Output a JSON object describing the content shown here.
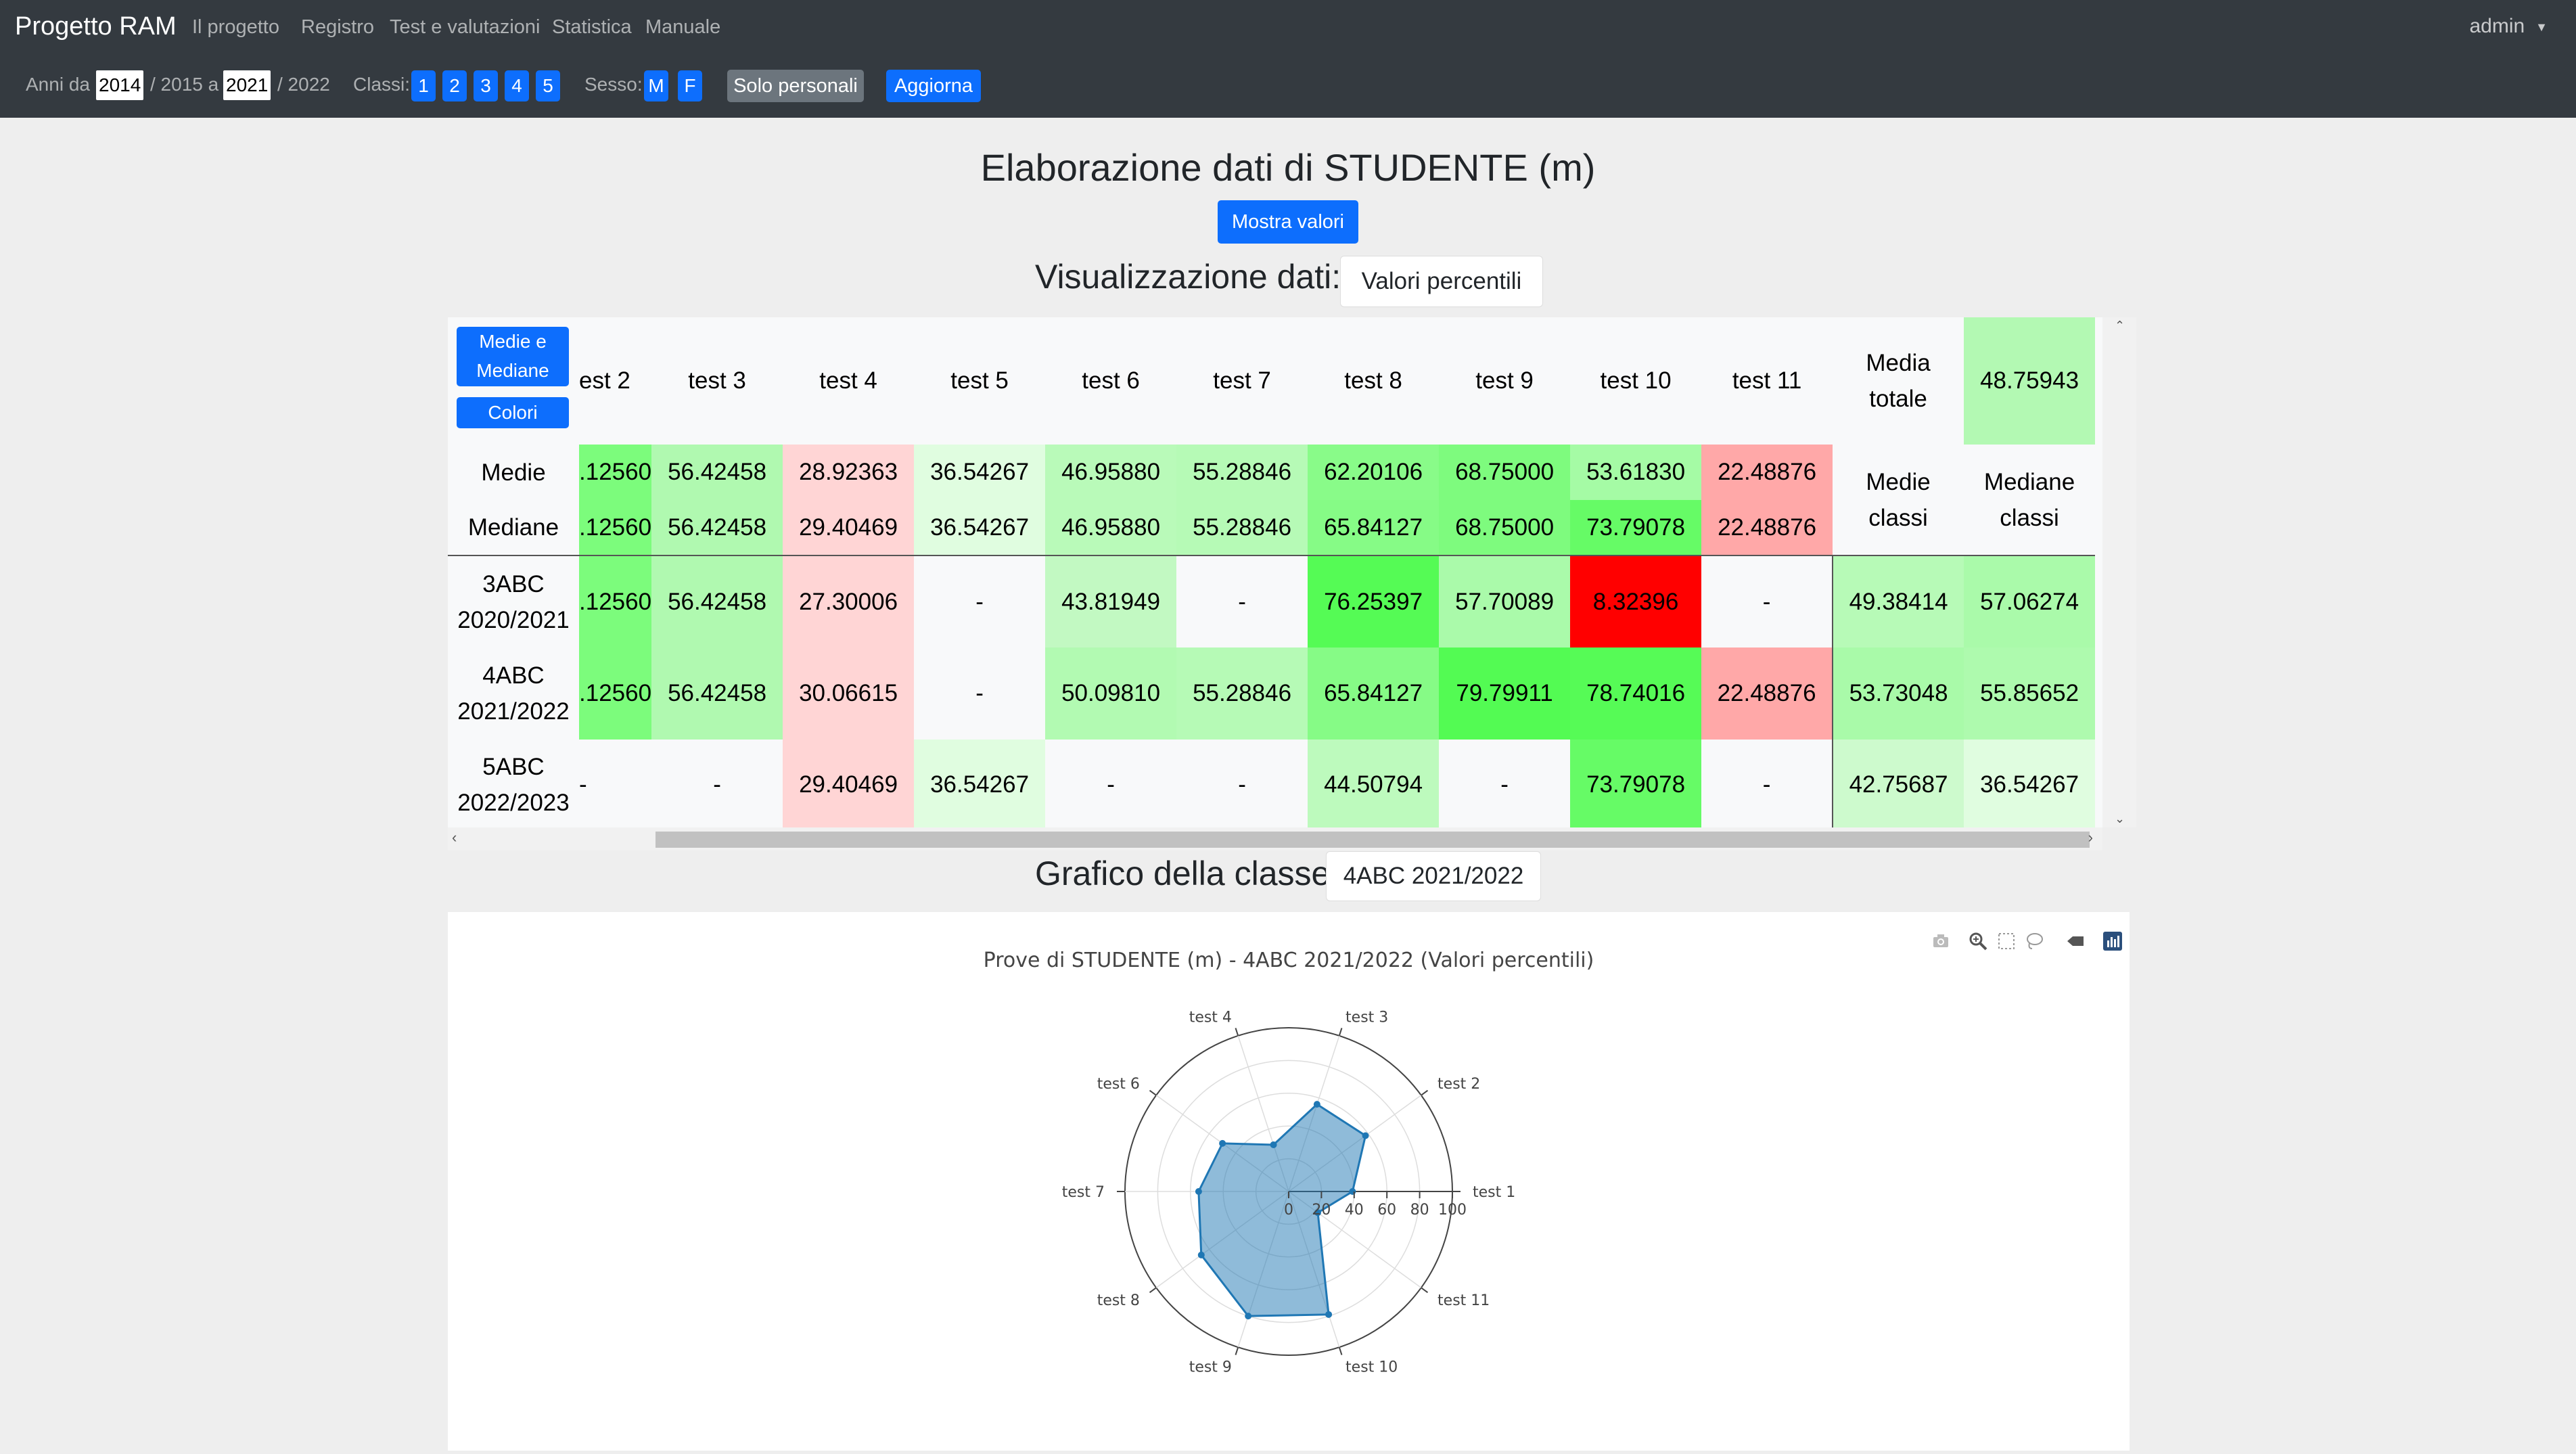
{
  "navbar": {
    "brand": "Progetto RAM",
    "links": [
      "Il progetto",
      "Registro",
      "Test e valutazioni",
      "Statistica",
      "Manuale"
    ],
    "user": "admin"
  },
  "filters": {
    "anni_da_label": "Anni da",
    "year_from": "2014",
    "year_from_suffix": "/ 2015 a",
    "year_to": "2021",
    "year_to_suffix": "/ 2022",
    "classi_label": "Classi:",
    "classi": [
      "1",
      "2",
      "3",
      "4",
      "5"
    ],
    "sesso_label": "Sesso:",
    "sesso": [
      "M",
      "F"
    ],
    "solo_personali": "Solo personali",
    "aggiorna": "Aggiorna"
  },
  "main": {
    "title": "Elaborazione dati di STUDENTE (m)",
    "mostra_valori": "Mostra valori",
    "visualizzazione_label": "Visualizzazione dati:",
    "visualizzazione_value": "Valori percentili",
    "grafico_label": "Grafico della classe",
    "grafico_value": "4ABC 2021/2022"
  },
  "table": {
    "btn_medie_line1": "Medie e",
    "btn_medie_line2": "Mediane",
    "btn_colori": "Colori",
    "test_headers": [
      "est 2",
      "test 3",
      "test 4",
      "test 5",
      "test 6",
      "test 7",
      "test 8",
      "test 9",
      "test 10",
      "test 11"
    ],
    "media_totale_label_1": "Media",
    "media_totale_label_2": "totale",
    "media_totale_value": "48.75943",
    "medie_classi_label_1": "Medie",
    "medie_classi_label_2": "classi",
    "mediane_classi_label_1": "Mediane",
    "mediane_classi_label_2": "classi",
    "rows": [
      {
        "label1": "Medie",
        "label2": "",
        "cells": [
          ".12560",
          "56.42458",
          "28.92363",
          "36.54267",
          "46.95880",
          "55.28846",
          "62.20106",
          "68.75000",
          "53.61830",
          "22.48876"
        ],
        "colors": [
          "#7cfc7c",
          "#b0f9b0",
          "#ffd5d5",
          "#e0fde0",
          "#b9fab9",
          "#b6fab6",
          "#89fb89",
          "#7efb7e",
          "#a5fba5",
          "#ffa8a8"
        ]
      },
      {
        "label1": "Mediane",
        "label2": "",
        "cells": [
          ".12560",
          "56.42458",
          "29.40469",
          "36.54267",
          "46.95880",
          "55.28846",
          "65.84127",
          "68.75000",
          "73.79078",
          "22.48876"
        ],
        "colors": [
          "#7cfc7c",
          "#b0f9b0",
          "#ffd5d5",
          "#e0fde0",
          "#b9fab9",
          "#b6fab6",
          "#86fb86",
          "#7efb7e",
          "#66fb66",
          "#ffa8a8"
        ]
      },
      {
        "label1": "3ABC",
        "label2": "2020/2021",
        "cells": [
          ".12560",
          "56.42458",
          "27.30006",
          "-",
          "43.81949",
          "-",
          "76.25397",
          "57.70089",
          "8.32396",
          "-"
        ],
        "colors": [
          "#7cfc7c",
          "#b0f9b0",
          "#ffd5d5",
          "#f8f9fa",
          "#c2f9c2",
          "#f8f9fa",
          "#55fb55",
          "#aafaaa",
          "#ff0000",
          "#f8f9fa"
        ],
        "medie_classi": "49.38414",
        "mediane_classi": "57.06274"
      },
      {
        "label1": "4ABC",
        "label2": "2021/2022",
        "cells": [
          ".12560",
          "56.42458",
          "30.06615",
          "-",
          "50.09810",
          "55.28846",
          "65.84127",
          "79.79911",
          "78.74016",
          "22.48876"
        ],
        "colors": [
          "#7cfc7c",
          "#b0f9b0",
          "#ffd5d5",
          "#f8f9fa",
          "#b2fab2",
          "#b6fab6",
          "#86fb86",
          "#53fb53",
          "#56fb56",
          "#ffa8a8"
        ],
        "medie_classi": "53.73048",
        "mediane_classi": "55.85652"
      },
      {
        "label1": "5ABC",
        "label2": "2022/2023",
        "cells": [
          "-",
          "-",
          "29.40469",
          "36.54267",
          "-",
          "-",
          "44.50794",
          "-",
          "73.79078",
          "-"
        ],
        "colors": [
          "#f8f9fa",
          "#f8f9fa",
          "#ffd5d5",
          "#e0fde0",
          "#f8f9fa",
          "#f8f9fa",
          "#bdfabd",
          "#f8f9fa",
          "#66fb66",
          "#f8f9fa"
        ],
        "medie_classi": "42.75687",
        "mediane_classi": "36.54267"
      }
    ],
    "summary_colors": {
      "media_totale": "#b3f9b3",
      "row3_medie": "#b7fab7",
      "row3_mediane": "#aafaaa",
      "row4_medie": "#a9faa9",
      "row4_mediane": "#aefaae",
      "row5_medie": "#cdfacd",
      "row5_mediane": "#e0fde0"
    }
  },
  "chart_data": {
    "type": "radar",
    "title": "Prove di STUDENTE  (m) - 4ABC 2021/2022 (Valori percentili)",
    "categories": [
      "test 1",
      "test 2",
      "test 3",
      "test 4",
      "test 6",
      "test 7",
      "test 8",
      "test 9",
      "test 10",
      "test 11"
    ],
    "values": [
      39,
      58,
      56,
      30,
      50,
      55,
      66,
      80,
      79,
      22
    ],
    "radial_range": [
      0,
      100
    ],
    "radial_ticks": [
      "0",
      "20",
      "40",
      "60",
      "80",
      "100"
    ],
    "fill_color": "#1f77b4"
  },
  "modebar": [
    "camera-icon",
    "zoom-icon",
    "box-select-icon",
    "lasso-icon",
    "eraser-icon",
    "plotly-logo-icon"
  ]
}
